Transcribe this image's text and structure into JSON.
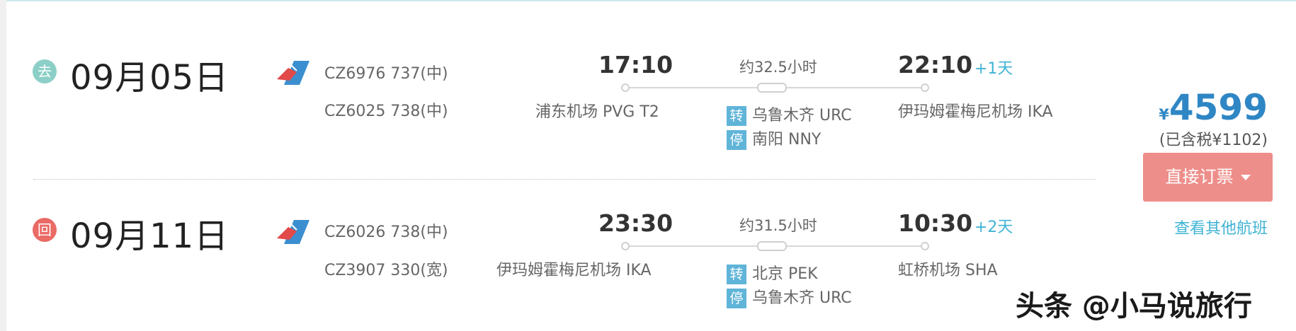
{
  "outbound": {
    "badge": "去",
    "date": "09月05日",
    "flights": [
      "CZ6976 737(中)",
      "CZ6025 738(中)"
    ],
    "depart_time": "17:10",
    "depart_airport": "浦东机场 PVG T2",
    "duration": "约32.5小时",
    "arrive_time": "22:10",
    "arrive_plus": "+1天",
    "arrive_airport": "伊玛姆霍梅尼机场 IKA",
    "stops": [
      {
        "tag": "转",
        "place": "乌鲁木齐 URC"
      },
      {
        "tag": "停",
        "place": "南阳 NNY"
      }
    ]
  },
  "return": {
    "badge": "回",
    "date": "09月11日",
    "flights": [
      "CZ6026 738(中)",
      "CZ3907 330(宽)"
    ],
    "depart_time": "23:30",
    "depart_airport": "伊玛姆霍梅尼机场 IKA",
    "duration": "约31.5小时",
    "arrive_time": "10:30",
    "arrive_plus": "+2天",
    "arrive_airport": "虹桥机场 SHA",
    "stops": [
      {
        "tag": "转",
        "place": "北京 PEK"
      },
      {
        "tag": "停",
        "place": "乌鲁木齐 URC"
      }
    ]
  },
  "price": {
    "currency": "¥",
    "amount": "4599",
    "tax_note": "(已含税¥1102)",
    "book_label": "直接订票",
    "other_flights_label": "查看其他航班"
  },
  "watermark": "头条 @小马说旅行",
  "colors": {
    "accent_blue": "#2f86c4",
    "link_blue": "#3fb3d4",
    "book_button": "#ee8e8a",
    "outbound_badge": "#8ccfc7",
    "return_badge": "#ea6a66",
    "stop_tag": "#5fb4d8"
  },
  "icons": {
    "airline_logo": "china-southern-kapok-icon",
    "dropdown": "caret-down-icon"
  }
}
